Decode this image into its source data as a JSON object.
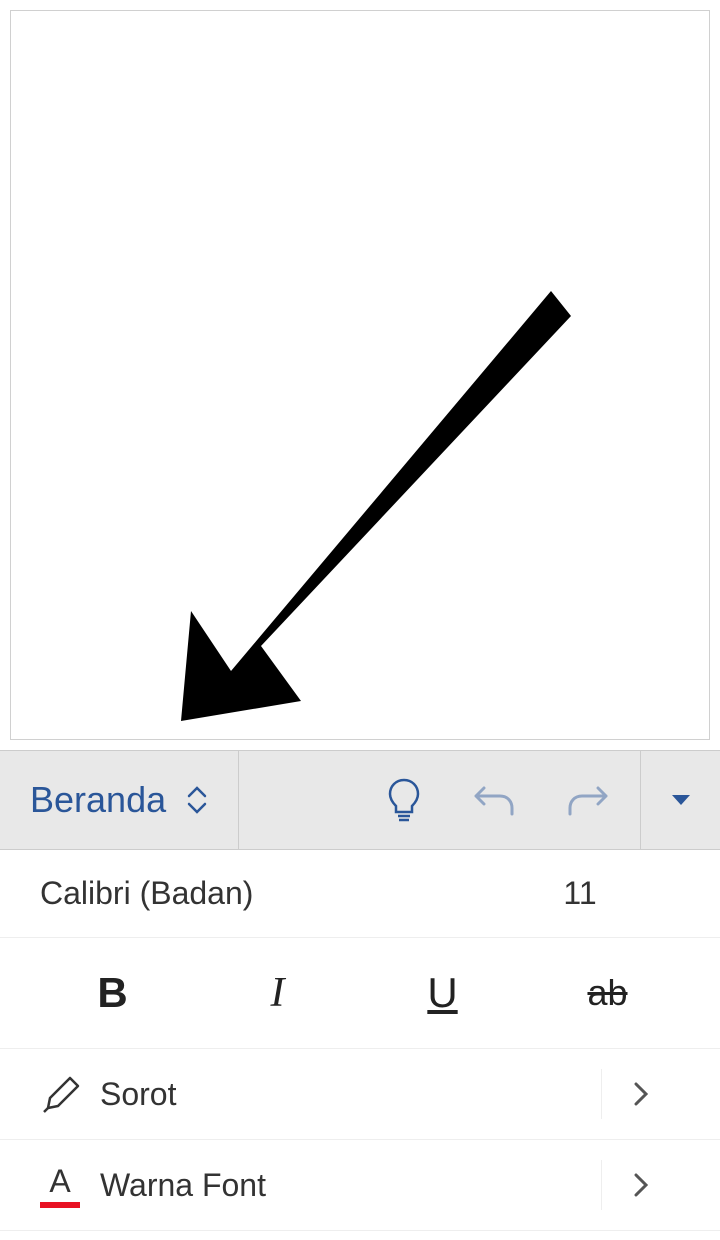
{
  "document": {
    "content": ""
  },
  "toolbar": {
    "tab_label": "Beranda",
    "icons": {
      "lightbulb": "lightbulb",
      "undo": "undo",
      "redo": "redo",
      "dropdown": "dropdown"
    }
  },
  "font": {
    "name": "Calibri (Badan)",
    "size": "11"
  },
  "format": {
    "bold": "B",
    "italic": "I",
    "underline": "U",
    "strike": "ab"
  },
  "options": {
    "highlight": {
      "label": "Sorot"
    },
    "font_color": {
      "label": "Warna Font",
      "glyph": "A"
    }
  }
}
